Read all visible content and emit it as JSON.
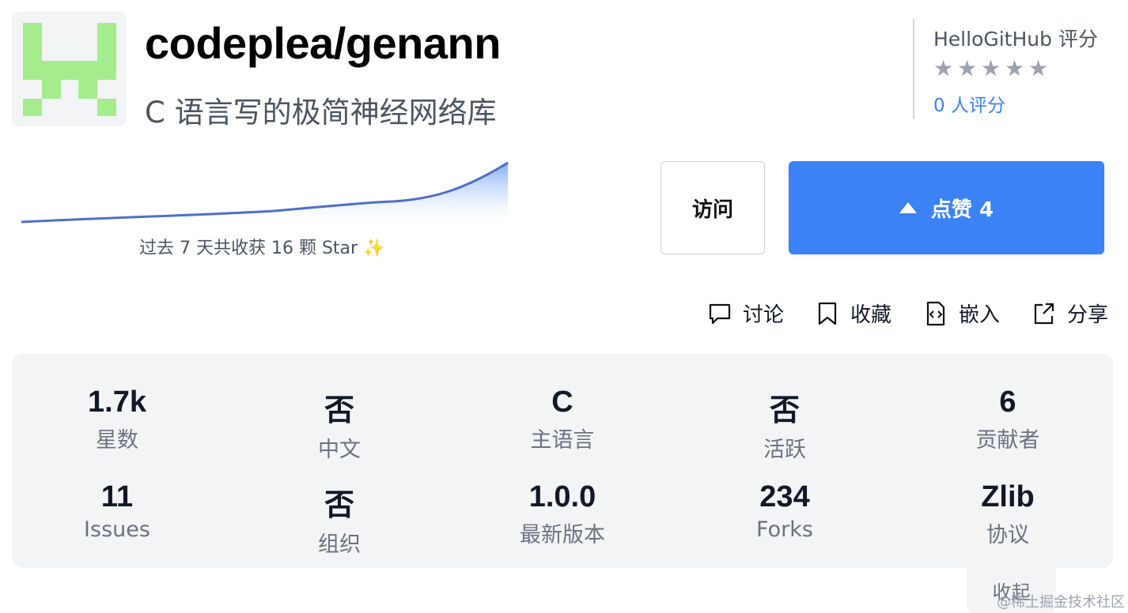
{
  "repo": {
    "name": "codeplea/genann",
    "description": "C 语言写的极简神经网络库",
    "logo_color": "#a5ec8f"
  },
  "rating": {
    "title": "HelloGitHub 评分",
    "stars": 5,
    "count_text": "0 人评分"
  },
  "spark": {
    "caption": "过去 7 天共收获 16 颗 Star ✨",
    "line_color": "#4f6fc8",
    "fill_color": "#7aa8f3"
  },
  "buttons": {
    "visit": "访问",
    "like": "点赞 4"
  },
  "actions": {
    "discuss": "讨论",
    "favorite": "收藏",
    "embed": "嵌入",
    "share": "分享"
  },
  "stats": [
    {
      "value": "1.7k",
      "label": "星数"
    },
    {
      "value": "否",
      "label": "中文"
    },
    {
      "value": "C",
      "label": "主语言"
    },
    {
      "value": "否",
      "label": "活跃"
    },
    {
      "value": "6",
      "label": "贡献者"
    },
    {
      "value": "11",
      "label": "Issues"
    },
    {
      "value": "否",
      "label": "组织"
    },
    {
      "value": "1.0.0",
      "label": "最新版本"
    },
    {
      "value": "234",
      "label": "Forks"
    },
    {
      "value": "Zlib",
      "label": "协议"
    }
  ],
  "collapse": "收起",
  "watermark": "@稀土掘金技术社区"
}
